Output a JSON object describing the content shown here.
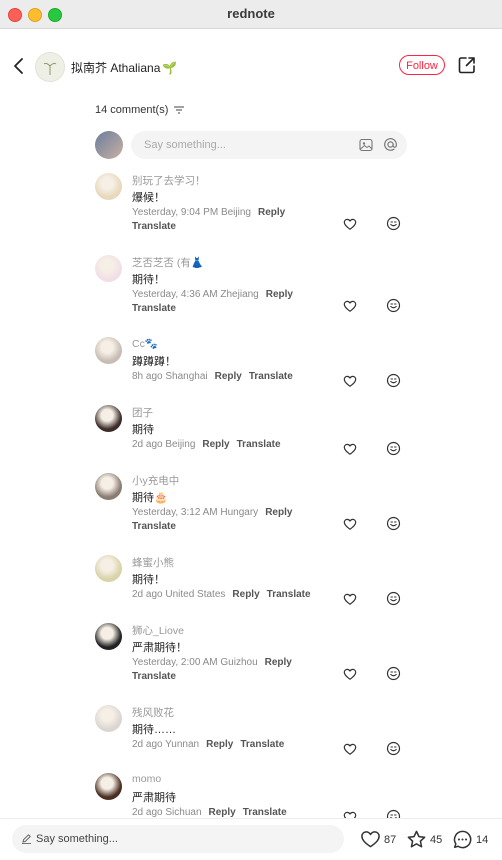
{
  "window": {
    "title": "rednote"
  },
  "author": {
    "name": "拟南芥 Athaliana",
    "emoji": "🌱"
  },
  "header": {
    "follow_label": "Follow"
  },
  "comments_header": {
    "count_label": "14 comment(s)"
  },
  "compose": {
    "placeholder": "Say something..."
  },
  "comments": [
    {
      "name": "别玩了去学习！",
      "text": "爆候！",
      "time": "Yesterday, 9:04 PM Beijing",
      "reply": "Reply",
      "translate": "Translate",
      "avatar": "#e8d8bc"
    },
    {
      "name": "芝否芝否 (有👗",
      "text": "期待！",
      "time": "Yesterday, 4:36 AM Zhejiang",
      "reply": "Reply",
      "translate": "Translate",
      "avatar": "#f2dfe6"
    },
    {
      "name": "Cc🐾",
      "text": "蹲蹲蹲！",
      "time": "8h ago Shanghai",
      "reply": "Reply",
      "translate": "Translate",
      "avatar": "#c8bdb5"
    },
    {
      "name": "团子",
      "text": "期待",
      "time": "2d ago Beijing",
      "reply": "Reply",
      "translate": "Translate",
      "avatar": "#3b2d2a"
    },
    {
      "name": "小y充电中",
      "text": "期待🎂",
      "time": "Yesterday, 3:12 AM Hungary",
      "reply": "Reply",
      "translate": "Translate",
      "avatar": "#8a7c72"
    },
    {
      "name": "蜂蜜小熊",
      "text": "期待！",
      "time": "2d ago United States",
      "reply": "Reply",
      "translate": "Translate",
      "avatar": "#d9d3a8"
    },
    {
      "name": "狮心_Liove",
      "text": "严肃期待！",
      "time": "Yesterday, 2:00 AM Guizhou",
      "reply": "Reply",
      "translate": "Translate",
      "avatar": "#222222"
    },
    {
      "name": "残风败花",
      "text": "期待……",
      "time": "2d ago Yunnan",
      "reply": "Reply",
      "translate": "Translate",
      "avatar": "#dcd6d2"
    },
    {
      "name": "momo",
      "text": "严肃期待",
      "time": "2d ago Sichuan",
      "reply": "Reply",
      "translate": "Translate",
      "avatar": "#4a2e22"
    }
  ],
  "bottom": {
    "placeholder": "Say something...",
    "likes": "87",
    "collects": "45",
    "comments": "14"
  }
}
